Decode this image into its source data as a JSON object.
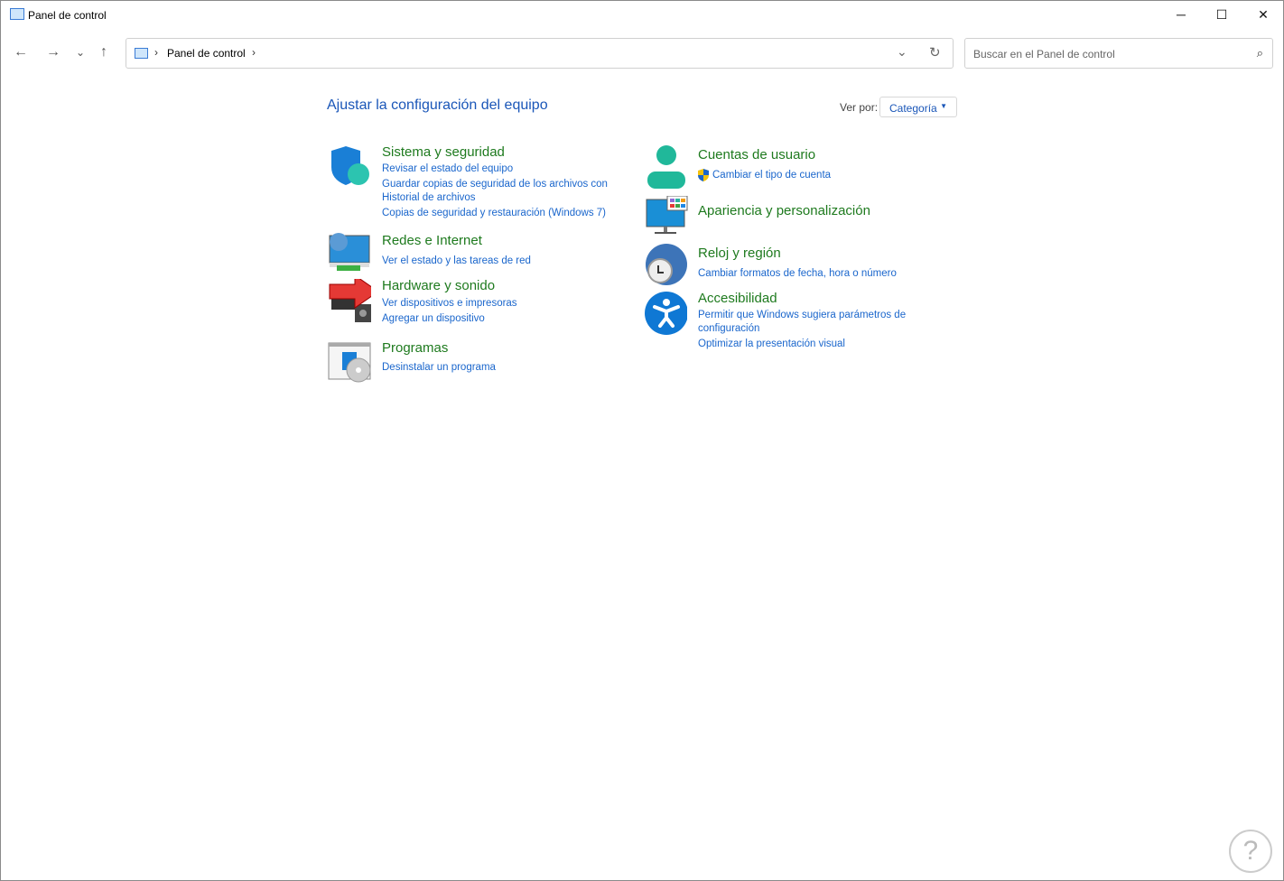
{
  "window": {
    "title": "Panel de control",
    "minimize": "─",
    "maximize": "☐",
    "close": "✕"
  },
  "nav": {
    "back": "←",
    "forward": "→",
    "recent": "⌄",
    "up": "↑"
  },
  "address": {
    "crumb": "Panel de control",
    "sep": "›",
    "dropdown": "⌄",
    "refresh": "↻"
  },
  "search": {
    "placeholder": "Buscar en el Panel de control",
    "icon": "⌕"
  },
  "main": {
    "heading": "Ajustar la configuración del equipo",
    "view_by_label": "Ver por:",
    "view_by_value": "Categoría"
  },
  "categories": [
    {
      "title": "Sistema y seguridad",
      "icon": "shield-icon",
      "links": [
        "Revisar el estado del equipo",
        "Guardar copias de seguridad de los archivos con",
        "Historial de archivos",
        "Copias de seguridad y restauración (Windows 7)"
      ]
    },
    {
      "title": "Redes e Internet",
      "icon": "network-icon",
      "links": [
        "Ver el estado y las tareas de red"
      ]
    },
    {
      "title": "Hardware y sonido",
      "icon": "printer-speaker-icon",
      "links": [
        "Ver dispositivos e impresoras",
        "Agregar un dispositivo"
      ]
    },
    {
      "title": "Programas",
      "icon": "programs-icon",
      "links": [
        "Desinstalar un programa"
      ]
    },
    {
      "title": "Cuentas de usuario",
      "icon": "user-icon",
      "links": [
        "Cambiar el tipo de cuenta"
      ]
    },
    {
      "title": "Apariencia y personalización",
      "icon": "monitor-icon",
      "links": []
    },
    {
      "title": "Reloj y región",
      "icon": "clock-globe-icon",
      "links": [
        "Cambiar formatos de fecha, hora o número"
      ]
    },
    {
      "title": "Accesibilidad",
      "icon": "accessibility-icon",
      "links": [
        "Permitir que Windows sugiera parámetros de",
        "configuración",
        "Optimizar la presentación visual"
      ]
    }
  ],
  "colors": {
    "heading": "#1e7a1e",
    "link": "#1a66cc"
  }
}
